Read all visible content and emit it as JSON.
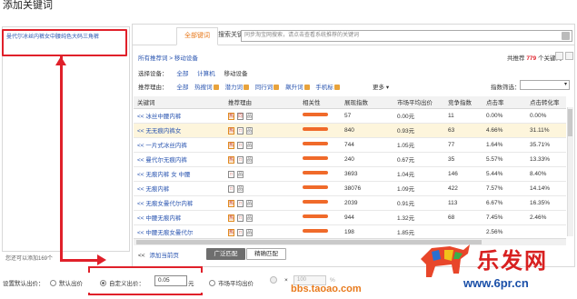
{
  "title": "添加关键词",
  "left_panel": {
    "selected": "曼代尔冰丝内裤女中腰纯色大码三角裤",
    "footer": "您还可以添加169个"
  },
  "tabs": [
    {
      "label": "全部键词"
    },
    {
      "label": "搜索关键词"
    }
  ],
  "search": {
    "placeholder": "同步淘宝网搜索，请点击查看系统推荐的关键词"
  },
  "breadcrumb": "所有推荐词 >  移动设备",
  "total": {
    "prefix": "共推荐",
    "count": "779",
    "suffix": "个关键词"
  },
  "filters": {
    "device_label": "选择设备：",
    "device_opts": [
      "全部",
      "计算机",
      "移动设备"
    ],
    "reason_label": "推荐理由：",
    "reason_opts": [
      "全部",
      "热搜词",
      "潜力词",
      "同行词",
      "飙升词",
      "手机标"
    ],
    "more": "更多",
    "index_label": "指数筛选：",
    "index_value": ""
  },
  "table": {
    "headers": [
      "关键词",
      "推荐理由",
      "相关性",
      "展现指数",
      "市场平均出价",
      "竞争指数",
      "点击率",
      "点击转化率"
    ],
    "rows": [
      {
        "kw": "<< 冰丝中腰内裤",
        "reasons": [
          "热",
          "同",
          "品"
        ],
        "imp": "57",
        "bid": "0.00元",
        "comp": "11",
        "ctr": "0.00%",
        "cvr": "0.00%",
        "hl": false
      },
      {
        "kw": "<< 无无痕内裤女",
        "reasons": [
          "热",
          "□",
          "品"
        ],
        "imp": "840",
        "bid": "0.93元",
        "comp": "63",
        "ctr": "4.66%",
        "cvr": "31.11%",
        "hl": true
      },
      {
        "kw": "<< 一片式冰丝内裤",
        "reasons": [
          "热",
          "□",
          "品"
        ],
        "imp": "744",
        "bid": "1.05元",
        "comp": "77",
        "ctr": "1.64%",
        "cvr": "35.71%",
        "hl": false
      },
      {
        "kw": "<< 曼代尔无痕内裤",
        "reasons": [
          "热",
          "□",
          "品"
        ],
        "imp": "240",
        "bid": "0.67元",
        "comp": "35",
        "ctr": "5.57%",
        "cvr": "13.33%",
        "hl": false
      },
      {
        "kw": "<< 无痕内裤 女 中腰",
        "reasons": [
          "□",
          "品"
        ],
        "imp": "3693",
        "bid": "1.04元",
        "comp": "146",
        "ctr": "5.44%",
        "cvr": "8.40%",
        "hl": false
      },
      {
        "kw": "<< 无痕内裤",
        "reasons": [
          "□",
          "品"
        ],
        "imp": "38076",
        "bid": "1.09元",
        "comp": "422",
        "ctr": "7.57%",
        "cvr": "14.14%",
        "hl": false
      },
      {
        "kw": "<< 无痕女曼代尔内裤",
        "reasons": [
          "热",
          "□",
          "品"
        ],
        "imp": "2039",
        "bid": "0.91元",
        "comp": "113",
        "ctr": "6.67%",
        "cvr": "16.35%",
        "hl": false
      },
      {
        "kw": "<< 中腰无痕内裤",
        "reasons": [
          "热",
          "□",
          "品"
        ],
        "imp": "944",
        "bid": "1.32元",
        "comp": "68",
        "ctr": "7.45%",
        "cvr": "2.46%",
        "hl": false
      },
      {
        "kw": "<< 中腰无痕女曼代尔",
        "reasons": [
          "热",
          "□",
          "品"
        ],
        "imp": "198",
        "bid": "1.85元",
        "comp": "",
        "ctr": "2.56%",
        "cvr": "",
        "hl": false
      }
    ]
  },
  "bottom": {
    "prefix": "<<",
    "add": "添加当前页",
    "btn_broad": "广泛匹配",
    "btn_exact": "精确匹配"
  },
  "footer": {
    "label": "设置默认出价：",
    "opt_default": "默认出价",
    "opt_custom": "自定义出价：",
    "custom_value": "0.05",
    "unit": "元",
    "opt_market": "市场平均出价",
    "pct_value": "100",
    "pct_unit": "%"
  },
  "watermark": {
    "brand": "乐发网",
    "site": "www.6pr.cn",
    "url": "bbs.taoao.com"
  }
}
